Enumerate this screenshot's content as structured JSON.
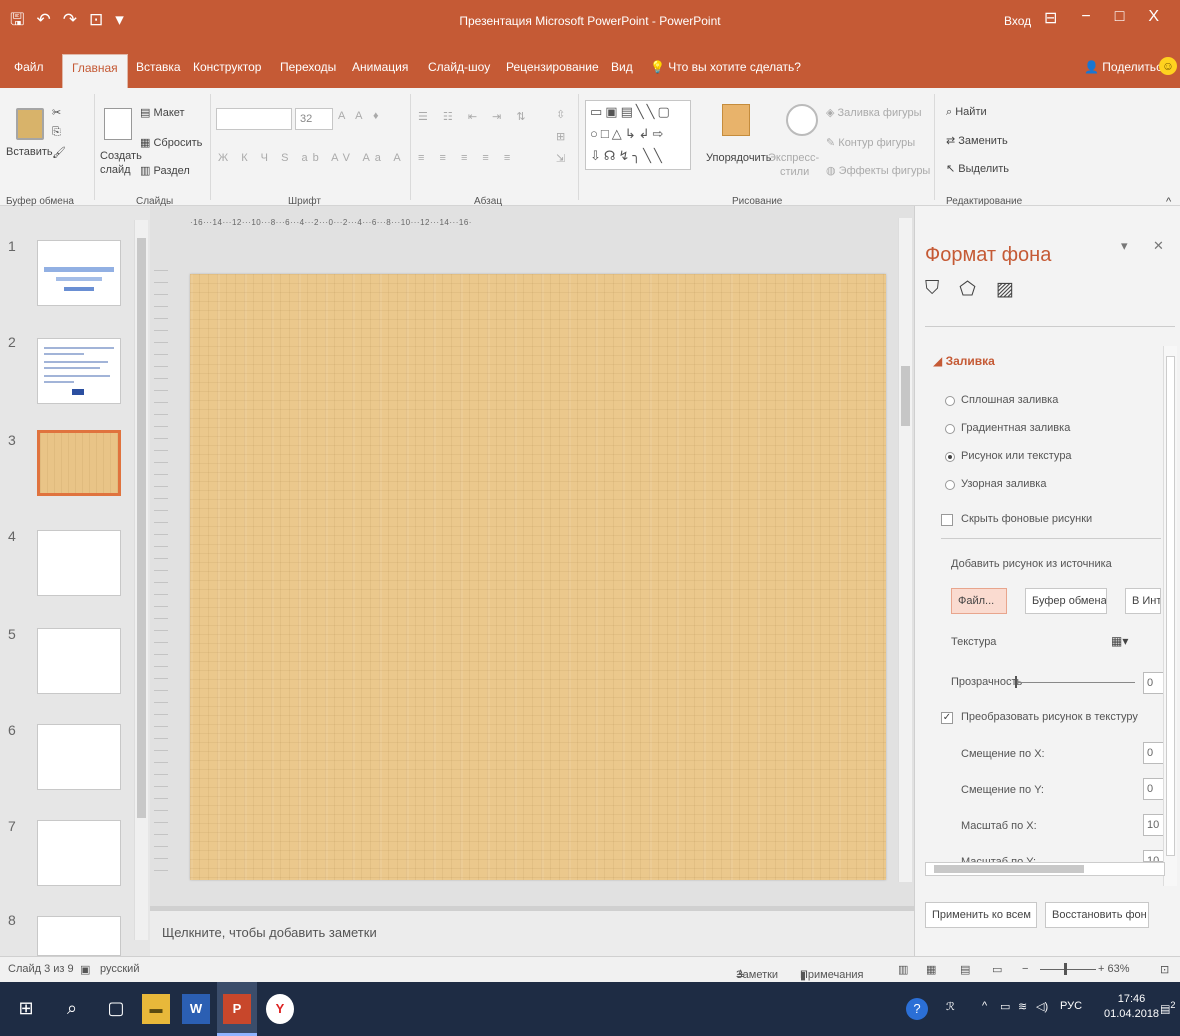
{
  "titlebar": {
    "title": "Презентация Microsoft PowerPoint - PowerPoint",
    "login": "Вход",
    "qat": [
      "save-icon",
      "undo-icon",
      "redo-icon",
      "start-from-beginning-icon"
    ],
    "window_buttons": [
      "⊟",
      "−",
      "□",
      "X"
    ]
  },
  "tabs": {
    "items": [
      {
        "label": "Файл",
        "active": false
      },
      {
        "label": "Главная",
        "active": true
      },
      {
        "label": "Вставка",
        "active": false
      },
      {
        "label": "Конструктор",
        "active": false
      },
      {
        "label": "Переходы",
        "active": false
      },
      {
        "label": "Анимация",
        "active": false
      },
      {
        "label": "Слайд-шоу",
        "active": false
      },
      {
        "label": "Рецензирование",
        "active": false
      },
      {
        "label": "Вид",
        "active": false
      }
    ],
    "tell_me": "Что вы хотите сделать?",
    "share": "Поделиться"
  },
  "ribbon": {
    "clipboard": {
      "paste": "Вставить",
      "label": "Буфер обмена"
    },
    "slides": {
      "create_line1": "Создать",
      "create_line2": "слайд",
      "layout": "Макет",
      "reset": "Сбросить",
      "section": "Раздел",
      "label": "Слайды"
    },
    "font": {
      "size": "32",
      "label": "Шрифт"
    },
    "paragraph": {
      "label": "Абзац"
    },
    "drawing": {
      "arrange": "Упорядочить",
      "express_line1": "Экспресс-",
      "express_line2": "стили",
      "fill": "Заливка фигуры",
      "outline": "Контур фигуры",
      "effects": "Эффекты фигуры",
      "label": "Рисование"
    },
    "editing": {
      "find": "Найти",
      "replace": "Заменить",
      "select": "Выделить",
      "label": "Редактирование"
    }
  },
  "thumbnails": [
    {
      "number": "1"
    },
    {
      "number": "2"
    },
    {
      "number": "3"
    },
    {
      "number": "4"
    },
    {
      "number": "5"
    },
    {
      "number": "6"
    },
    {
      "number": "7"
    },
    {
      "number": "8"
    }
  ],
  "ruler_text": "·16···14···12···10···8···6···4···2···0···2···4···6···8···10···12···14···16·",
  "notes_placeholder": "Щелкните, чтобы добавить заметки",
  "pane": {
    "title": "Формат фона",
    "section": "Заливка",
    "options": {
      "solid": "Сплошная заливка",
      "gradient": "Градиентная заливка",
      "picture": "Рисунок или текстура",
      "pattern": "Узорная заливка",
      "hide": "Скрыть фоновые рисунки"
    },
    "insert_from": "Добавить рисунок из источника",
    "buttons": {
      "file": "Файл...",
      "clipboard": "Буфер обмена",
      "online": "В Инт"
    },
    "texture": "Текстура",
    "transparency": "Прозрачность",
    "transparency_value": "0",
    "tile": "Преобразовать рисунок в текстуру",
    "offset_x": "Смещение по X:",
    "offset_x_value": "0",
    "offset_y": "Смещение по Y:",
    "offset_y_value": "0",
    "scale_x": "Масштаб по X:",
    "scale_x_value": "10",
    "scale_y": "Масштаб по Y:",
    "scale_y_value": "10",
    "apply_all": "Применить ко всем",
    "reset": "Восстановить фон"
  },
  "status": {
    "slide_info": "Слайд 3 из 9",
    "language": "русский",
    "notes": "Заметки",
    "comments": "Примечания",
    "zoom": "+ 63%"
  },
  "taskbar": {
    "lang": "РУС",
    "time": "17:46",
    "date": "01.04.2018",
    "notification_count": "2"
  }
}
